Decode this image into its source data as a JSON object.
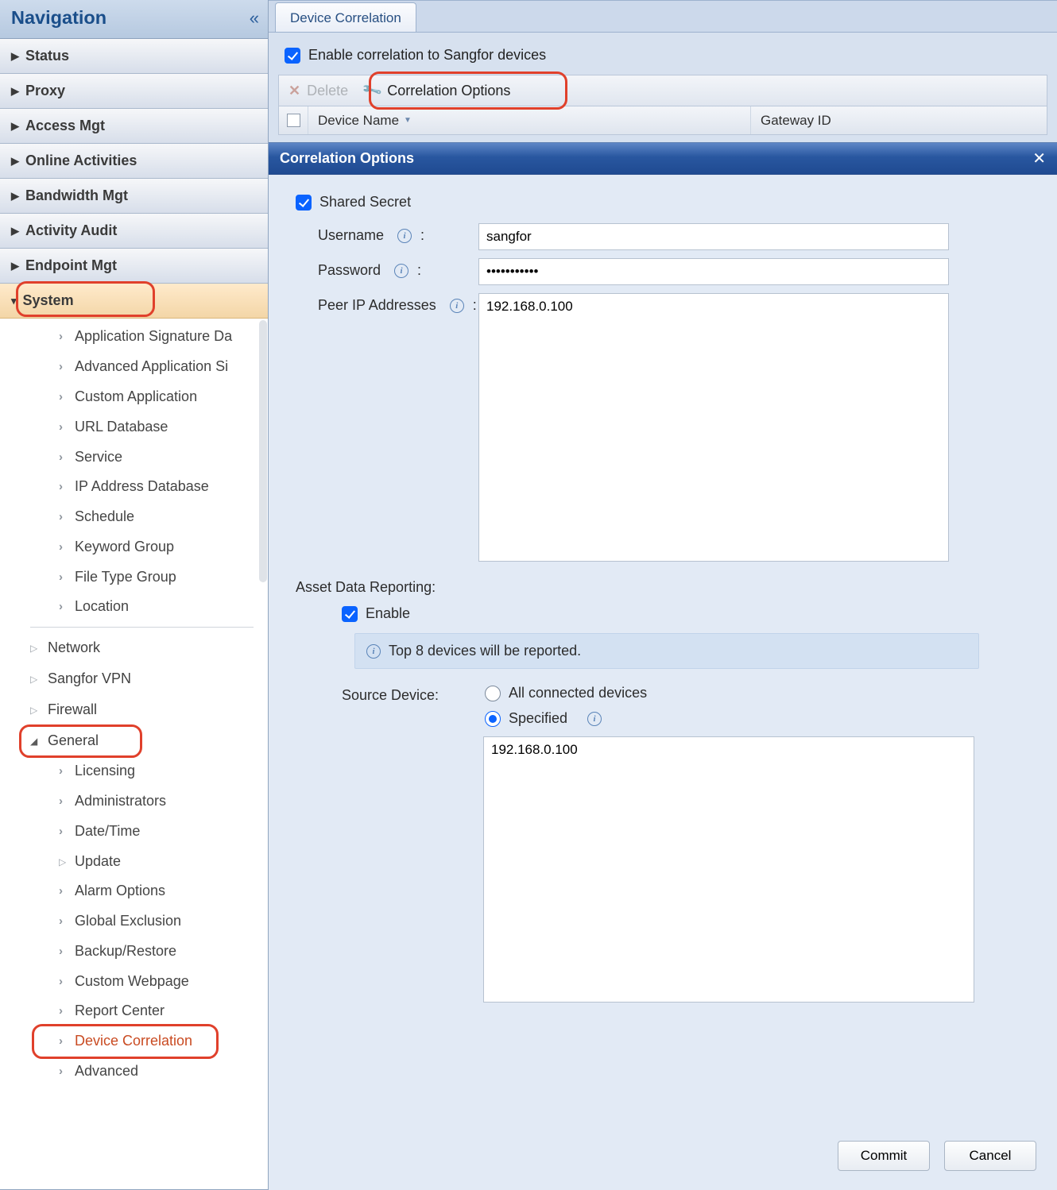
{
  "sidebar": {
    "title": "Navigation",
    "collapse_glyph": "«",
    "sections": {
      "status": "Status",
      "proxy": "Proxy",
      "access_mgt": "Access Mgt",
      "online_activities": "Online Activities",
      "bandwidth_mgt": "Bandwidth Mgt",
      "activity_audit": "Activity Audit",
      "endpoint_mgt": "Endpoint Mgt",
      "system": "System"
    },
    "system_tree": {
      "objects_children": [
        "Application Signature Da",
        "Advanced Application Si",
        "Custom Application",
        "URL Database",
        "Service",
        "IP Address Database",
        "Schedule",
        "Keyword Group",
        "File Type Group",
        "Location"
      ],
      "groups": {
        "network": "Network",
        "sangfor_vpn": "Sangfor VPN",
        "firewall": "Firewall",
        "general": "General"
      },
      "general_children": [
        "Licensing",
        "Administrators",
        "Date/Time",
        "Update",
        "Alarm Options",
        "Global Exclusion",
        "Backup/Restore",
        "Custom Webpage",
        "Report Center",
        "Device Correlation",
        "Advanced"
      ]
    }
  },
  "main": {
    "tab_label": "Device Correlation",
    "enable_label": "Enable correlation to Sangfor devices",
    "enable_checked": true,
    "toolbar": {
      "delete": "Delete",
      "corr_opts": "Correlation Options"
    },
    "grid": {
      "col_device_name": "Device Name",
      "col_gateway_id": "Gateway ID"
    }
  },
  "dialog": {
    "title": "Correlation Options",
    "shared_secret_label": "Shared Secret",
    "shared_secret_checked": true,
    "username_label": "Username",
    "username_value": "sangfor",
    "password_label": "Password",
    "password_value": "•••••••••••",
    "peer_label": "Peer IP Addresses",
    "peer_value": "192.168.0.100",
    "asset_section": "Asset Data Reporting:",
    "asset_enable_label": "Enable",
    "asset_enable_checked": true,
    "info_msg": "Top 8 devices will be reported.",
    "source_label": "Source Device:",
    "radio_all": "All connected devices",
    "radio_specified": "Specified",
    "radio_selected": "specified",
    "specified_value": "192.168.0.100",
    "commit": "Commit",
    "cancel": "Cancel"
  }
}
